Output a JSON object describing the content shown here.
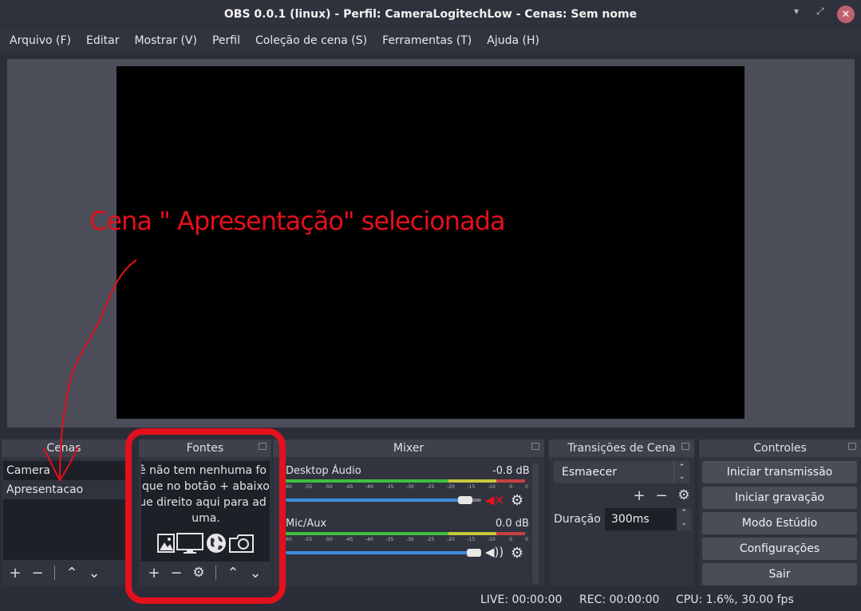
{
  "window": {
    "title": "OBS 0.0.1 (linux) - Perfil: CameraLogitechLow - Cenas: Sem nome"
  },
  "menu": [
    "Arquivo (F)",
    "Editar",
    "Mostrar (V)",
    "Perfil",
    "Coleção de cena (S)",
    "Ferramentas (T)",
    "Ajuda (H)"
  ],
  "docks": {
    "scenes": {
      "title": "Cenas",
      "items": [
        "Camera",
        "Apresentacao"
      ],
      "selected": "Apresentacao"
    },
    "sources": {
      "title": "Fontes",
      "empty_lines": [
        "ê não tem nenhuma fo",
        "lique no botão + abaixo",
        "ue direito aqui para ad",
        "uma."
      ]
    },
    "mixer": {
      "title": "Mixer",
      "channels": [
        {
          "name": "Desktop Áudio",
          "db": "-0.8 dB",
          "muted": true,
          "volume": 0.95
        },
        {
          "name": "Mic/Aux",
          "db": "0.0 dB",
          "muted": false,
          "volume": 1.0
        }
      ],
      "ticks": [
        "-60",
        "-55",
        "-50",
        "-45",
        "-40",
        "-35",
        "-30",
        "-25",
        "-20",
        "-15",
        "-10",
        "-5",
        "0"
      ]
    },
    "transitions": {
      "title": "Transições de Cena",
      "selected": "Esmaecer",
      "duration_label": "Duração",
      "duration": "300ms"
    },
    "controls": {
      "title": "Controles",
      "buttons": [
        "Iniciar transmissão",
        "Iniciar gravação",
        "Modo Estúdio",
        "Configurações",
        "Sair"
      ]
    }
  },
  "status": {
    "live": "LIVE: 00:00:00",
    "rec": "REC: 00:00:00",
    "cpu": "CPU: 1.6%, 30.00 fps"
  },
  "annotation": "Cena \" Apresentação\" selecionada",
  "colors": {
    "annotation": "#e4101b",
    "meter_green": "#3fbe3f",
    "meter_yellow": "#c8c83f",
    "volume_blue": "#3c8ee0"
  }
}
